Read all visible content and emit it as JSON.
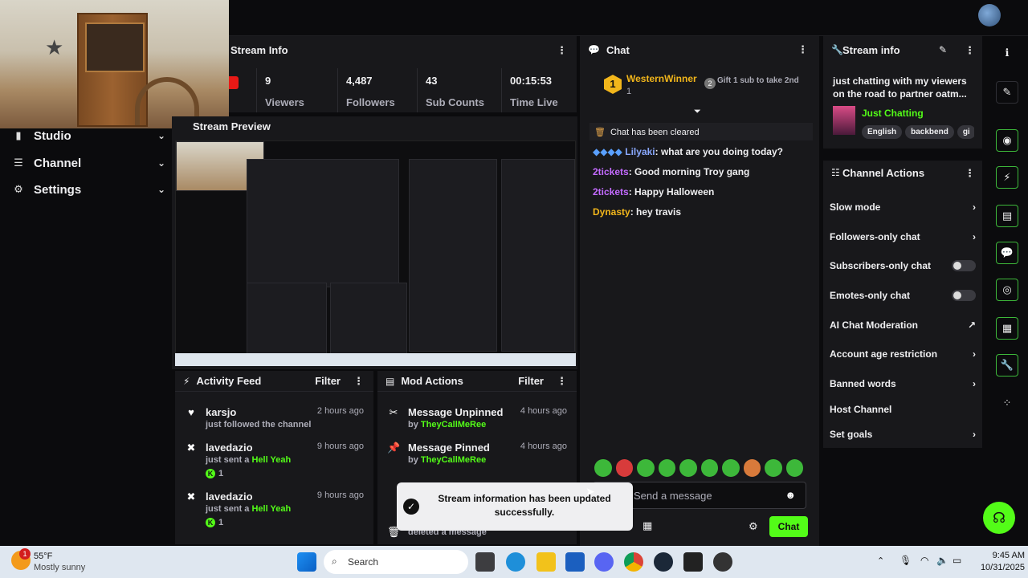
{
  "stats": {
    "title": "Stream Info",
    "items": [
      {
        "value": "9",
        "label": "Viewers"
      },
      {
        "value": "4,487",
        "label": "Followers"
      },
      {
        "value": "43",
        "label": "Sub Counts"
      },
      {
        "value": "00:15:53",
        "label": "Time Live"
      }
    ]
  },
  "nav": {
    "items": [
      {
        "label": "Studio",
        "icon": "video-icon"
      },
      {
        "label": "Channel",
        "icon": "list-icon"
      },
      {
        "label": "Settings",
        "icon": "gear-icon"
      }
    ]
  },
  "preview": {
    "title": "Stream Preview"
  },
  "activity": {
    "title": "Activity Feed",
    "filter": "Filter",
    "rows": [
      {
        "name": "karsjo",
        "desc": "just followed the channel",
        "time": "2 hours ago",
        "icon": "heart-icon"
      },
      {
        "name": "lavedazio",
        "desc": "just sent a",
        "gift": "Hell Yeah",
        "count": "1",
        "time": "9 hours ago",
        "icon": "kick-icon"
      },
      {
        "name": "lavedazio",
        "desc": "just sent a",
        "gift": "Hell Yeah",
        "count": "1",
        "time": "9 hours ago",
        "icon": "kick-icon"
      }
    ]
  },
  "mod": {
    "title": "Mod Actions",
    "filter": "Filter",
    "rows": [
      {
        "name": "Message Unpinned",
        "by": "by",
        "user": "TheyCallMeRee",
        "time": "4 hours ago"
      },
      {
        "name": "Message Pinned",
        "by": "by",
        "user": "TheyCallMeRee",
        "time": "4 hours ago"
      }
    ],
    "partial": "deleted a message"
  },
  "chat": {
    "title": "Chat",
    "top_gifter": {
      "name": "WesternWinner",
      "rank": "1",
      "count": "1"
    },
    "gift_prompt": "Gift 1 sub to take 2nd",
    "cleared": "Chat has been cleared",
    "messages": [
      {
        "user": "Lilyaki",
        "text": ": what are you doing today?"
      },
      {
        "user": "2tickets",
        "text": ": Good morning Troy gang"
      },
      {
        "user": "2tickets",
        "text": ": Happy Halloween"
      },
      {
        "user": "Dynasty",
        "text": ": hey travis"
      }
    ],
    "placeholder": "Send a message",
    "send_label": "Chat"
  },
  "stream_info": {
    "title": "Stream info",
    "description": "just chatting with my viewers on the road to partner oatm...",
    "category": "Just Chatting",
    "tags": [
      "English",
      "backbend",
      "gi"
    ]
  },
  "actions": {
    "title": "Channel Actions",
    "items": [
      {
        "label": "Slow mode",
        "kind": "chevron"
      },
      {
        "label": "Followers-only chat",
        "kind": "chevron"
      },
      {
        "label": "Subscribers-only chat",
        "kind": "toggle"
      },
      {
        "label": "Emotes-only chat",
        "kind": "toggle"
      },
      {
        "label": "AI Chat Moderation",
        "kind": "external"
      },
      {
        "label": "Account age restriction",
        "kind": "chevron"
      },
      {
        "label": "Banned words",
        "kind": "chevron"
      },
      {
        "label": "Host Channel",
        "kind": "none"
      },
      {
        "label": "Set goals",
        "kind": "chevron"
      }
    ]
  },
  "toast": {
    "text": "Stream information has been updated successfully."
  },
  "taskbar": {
    "weather_temp": "55°F",
    "weather_desc": "Mostly sunny",
    "search": "Search",
    "time": "9:45 AM",
    "date": "10/31/2025",
    "weather_badge": "1"
  },
  "colors": {
    "accent": "#53fc18",
    "bg": "#0b0b0d",
    "panel": "#18181b"
  }
}
